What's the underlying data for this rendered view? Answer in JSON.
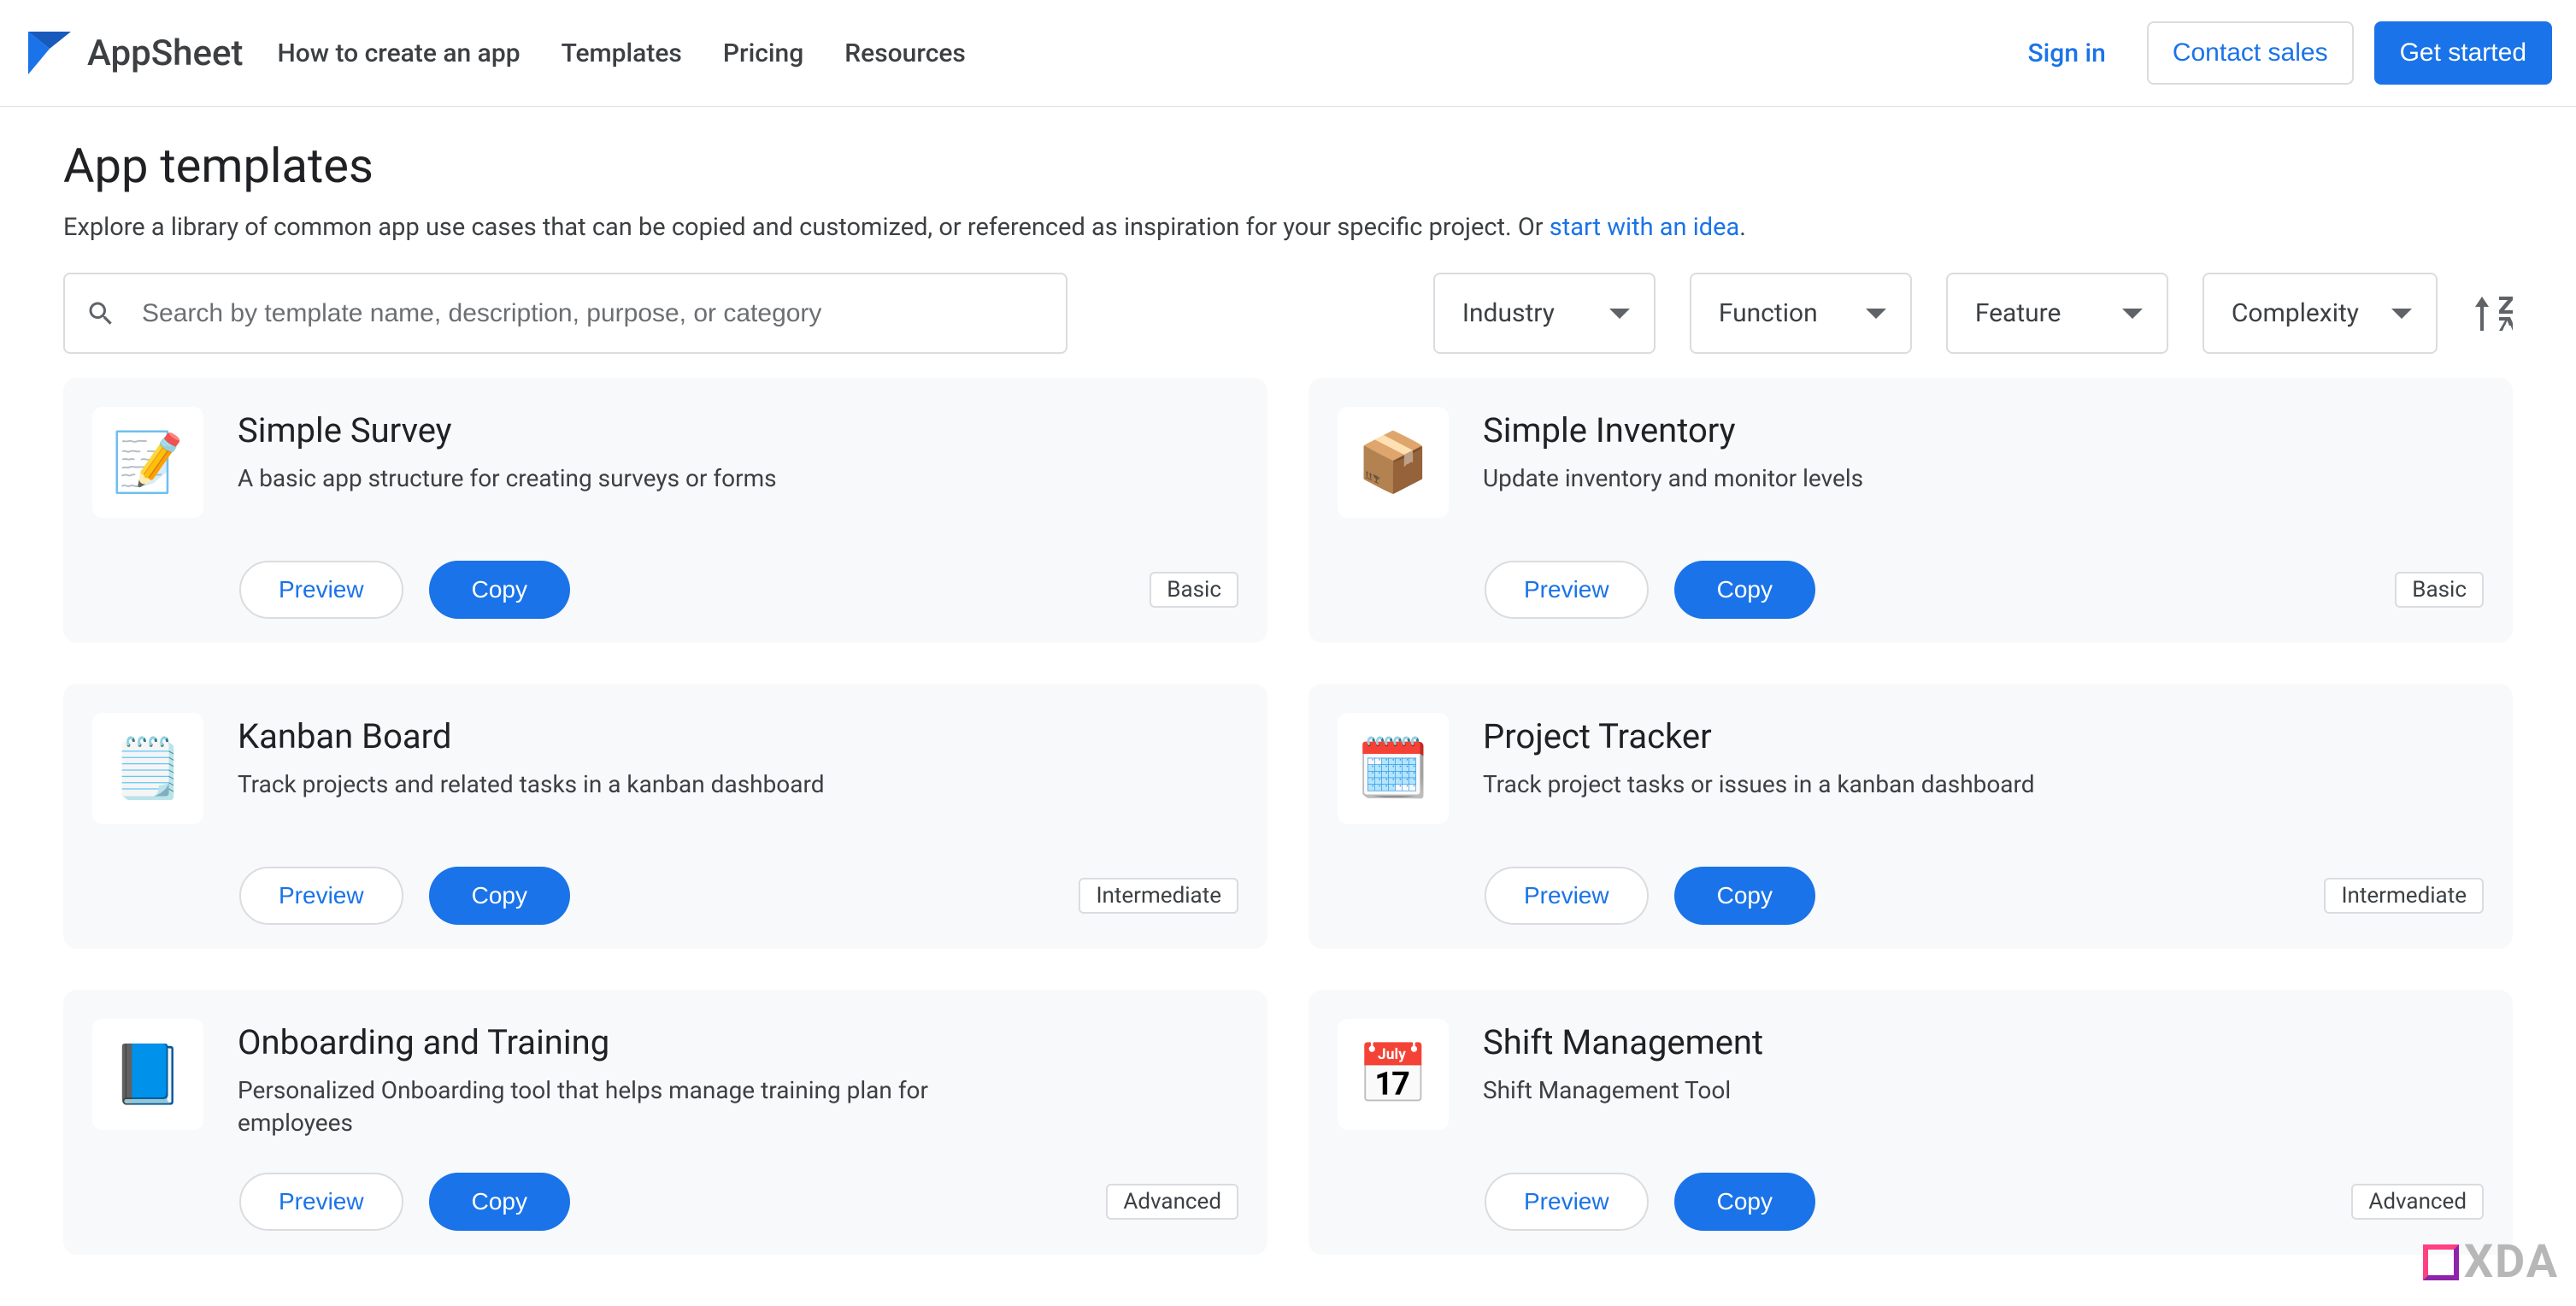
{
  "header": {
    "brand": "AppSheet",
    "nav": {
      "how_to": "How to create an app",
      "templates": "Templates",
      "pricing": "Pricing",
      "resources": "Resources"
    },
    "actions": {
      "sign_in": "Sign in",
      "contact_sales": "Contact sales",
      "get_started": "Get started"
    }
  },
  "page": {
    "title": "App templates",
    "subtitle_prefix": "Explore a library of common app use cases that can be copied and customized, or referenced as inspiration for your specific project. Or ",
    "subtitle_link": "start with an idea",
    "subtitle_suffix": "."
  },
  "controls": {
    "search_placeholder": "Search by template name, description, purpose, or category",
    "search_value": "",
    "industry_label": "Industry",
    "function_label": "Function",
    "feature_label": "Feature",
    "complexity_label": "Complexity"
  },
  "labels": {
    "preview": "Preview",
    "copy": "Copy"
  },
  "badges": {
    "basic": "Basic",
    "intermediate": "Intermediate",
    "advanced": "Advanced"
  },
  "cards": [
    {
      "icon": "📝",
      "title": "Simple Survey",
      "desc": "A basic app structure for creating surveys or forms",
      "level": "basic"
    },
    {
      "icon": "📦",
      "title": "Simple Inventory",
      "desc": "Update inventory and monitor levels",
      "level": "basic"
    },
    {
      "icon": "🗒️",
      "title": "Kanban Board",
      "desc": "Track projects and related tasks in a kanban dashboard",
      "level": "intermediate"
    },
    {
      "icon": "🗓️",
      "title": "Project Tracker",
      "desc": "Track project tasks or issues in a kanban dashboard",
      "level": "intermediate"
    },
    {
      "icon": "📘",
      "title": "Onboarding and Training",
      "desc": "Personalized Onboarding tool that helps manage training plan for employees",
      "level": "advanced"
    },
    {
      "icon": "📅",
      "title": "Shift Management",
      "desc": "Shift Management Tool",
      "level": "advanced"
    }
  ],
  "watermark": "XDA"
}
